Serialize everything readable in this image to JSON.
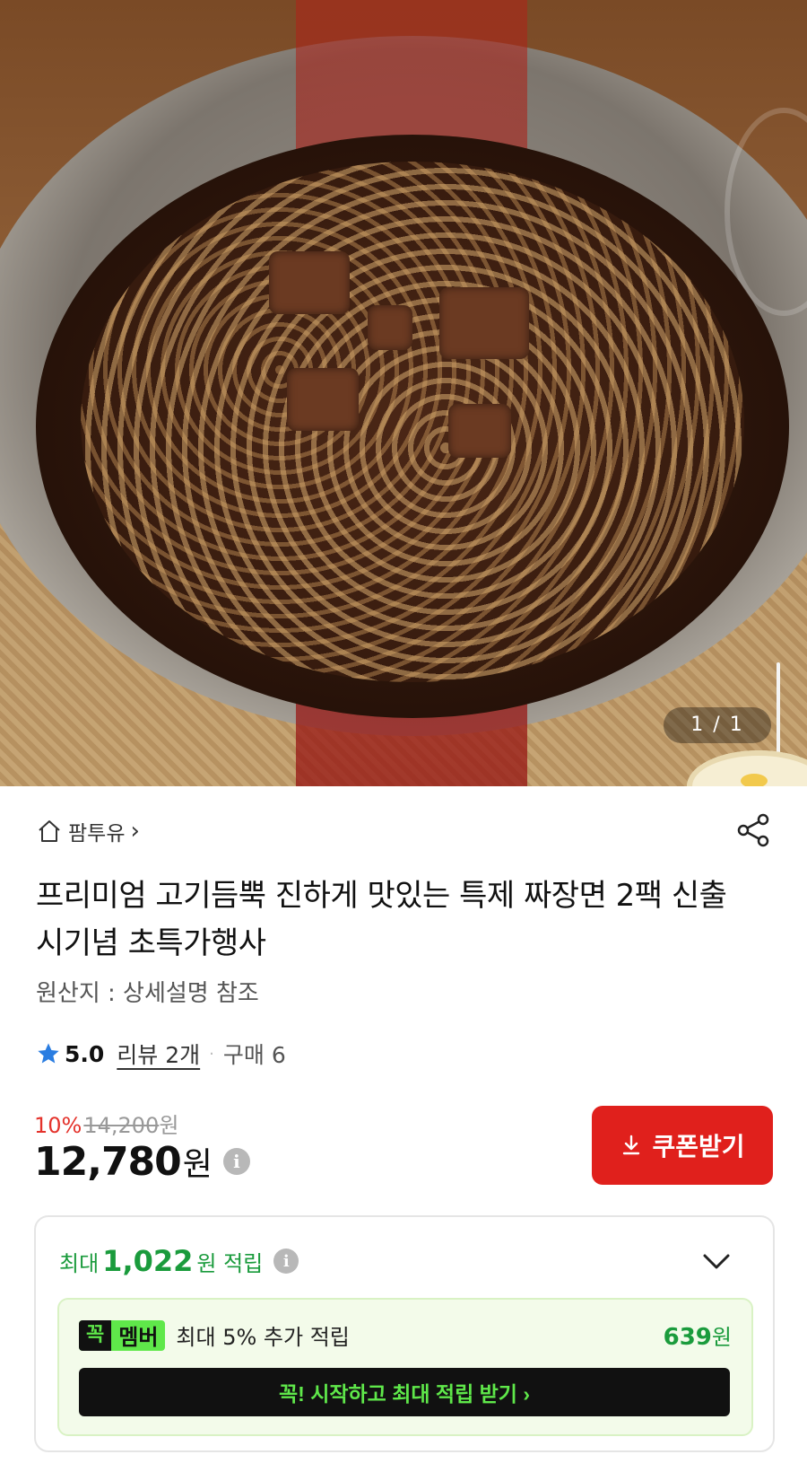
{
  "hero": {
    "image_description_icon": "jjajangmyeon-photo",
    "counter": "1 / 1"
  },
  "store": {
    "name": "팜투유",
    "arrow": "›"
  },
  "product": {
    "title": "프리미엄 고기듬뿍 진하게 맛있는 특제 짜장면 2팩 신출시기념 초특가행사",
    "origin": "원산지 : 상세설명 참조"
  },
  "rating": {
    "score": "5.0",
    "reviews": "리뷰 2개",
    "separator": "·",
    "purchases": "구매 6"
  },
  "price": {
    "discount_pct": "10%",
    "original": "14,200",
    "original_unit": "원",
    "final": "12,780",
    "final_unit": "원",
    "info_icon": "i"
  },
  "coupon": {
    "label": "쿠폰받기",
    "icon": "download-icon"
  },
  "reward": {
    "prefix": "최대",
    "amount": "1,022",
    "suffix": "원 적립",
    "info_icon": "i",
    "member": {
      "badge_left": "꼭",
      "badge_right": "멤버",
      "text": "최대 5% 추가 적립",
      "amount": "639",
      "amount_unit": "원",
      "button": "꼭! 시작하고 최대 적립 받기  ›"
    }
  },
  "colors": {
    "accent_red": "#e0201c",
    "discount_red": "#e4322b",
    "reward_green": "#1a9b3c",
    "member_green": "#5fe84a"
  }
}
